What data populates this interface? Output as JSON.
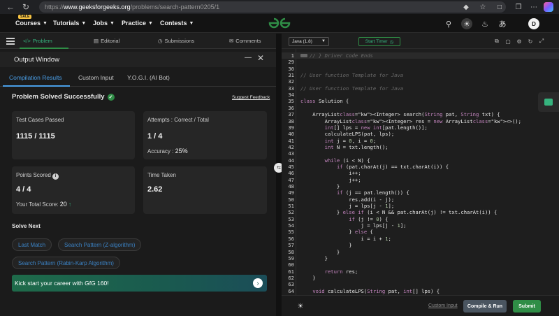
{
  "browser": {
    "url_prefix": "https://",
    "url_host": "www.geeksforgeeks.org",
    "url_path": "/problems/search-pattern0205/1"
  },
  "header": {
    "sale_badge": "SALE",
    "menu": [
      {
        "label": "Courses"
      },
      {
        "label": "Tutorials"
      },
      {
        "label": "Jobs"
      },
      {
        "label": "Practice"
      },
      {
        "label": "Contests"
      }
    ],
    "avatar_letter": "D"
  },
  "problem_tabs": [
    {
      "label": "Problem",
      "icon": "code-icon",
      "active": true
    },
    {
      "label": "Editorial",
      "icon": "book-icon",
      "active": false
    },
    {
      "label": "Submissions",
      "icon": "clock-icon",
      "active": false
    },
    {
      "label": "Comments",
      "icon": "comment-icon",
      "active": false
    }
  ],
  "output_window": {
    "title": "Output Window",
    "tabs": [
      {
        "label": "Compilation Results",
        "active": true
      },
      {
        "label": "Custom Input",
        "active": false
      },
      {
        "label": "Y.O.G.I. (AI Bot)",
        "active": false
      }
    ],
    "status": "Problem Solved Successfully",
    "suggest_feedback": "Suggest Feedback",
    "cards": {
      "test_cases": {
        "label": "Test Cases Passed",
        "value": "1115 / 1115"
      },
      "attempts": {
        "label": "Attempts : Correct / Total",
        "value": "1 / 4",
        "accuracy_label": "Accuracy :",
        "accuracy_value": "25%"
      },
      "points": {
        "label": "Points Scored",
        "value": "4 / 4",
        "total_label": "Your Total Score:",
        "total_value": "20"
      },
      "time": {
        "label": "Time Taken",
        "value": "2.62"
      }
    },
    "solve_next_title": "Solve Next",
    "solve_next": [
      "Last Match",
      "Search Pattern (Z-algorithm)",
      "Search Pattern (Rabin-Karp Algorithm)"
    ],
    "banner": "Kick start your career with GfG 160!"
  },
  "editor": {
    "language": "Java (1.8)",
    "timer_label": "Start Timer",
    "custom_input": "Custom Input",
    "compile_label": "Compile & Run",
    "submit_label": "Submit",
    "lines": [
      {
        "n": "1",
        "t": "// } Driver Code Ends"
      },
      {
        "n": "29",
        "t": ""
      },
      {
        "n": "30",
        "t": ""
      },
      {
        "n": "31",
        "t": "// User function Template for Java"
      },
      {
        "n": "32",
        "t": ""
      },
      {
        "n": "33",
        "t": "// User function Template for Java"
      },
      {
        "n": "34",
        "t": ""
      },
      {
        "n": "35",
        "t": "class Solution {"
      },
      {
        "n": "36",
        "t": ""
      },
      {
        "n": "37",
        "t": "    ArrayList<Integer> search(String pat, String txt) {"
      },
      {
        "n": "38",
        "t": "        ArrayList<Integer> res = new ArrayList<>();"
      },
      {
        "n": "39",
        "t": "        int[] lps = new int[pat.length()];"
      },
      {
        "n": "40",
        "t": "        calculateLPS(pat, lps);"
      },
      {
        "n": "41",
        "t": "        int j = 0, i = 0;"
      },
      {
        "n": "42",
        "t": "        int N = txt.length();"
      },
      {
        "n": "43",
        "t": ""
      },
      {
        "n": "44",
        "t": "        while (i < N) {"
      },
      {
        "n": "45",
        "t": "            if (pat.charAt(j) == txt.charAt(i)) {"
      },
      {
        "n": "46",
        "t": "                i++;"
      },
      {
        "n": "47",
        "t": "                j++;"
      },
      {
        "n": "48",
        "t": "            }"
      },
      {
        "n": "49",
        "t": "            if (j == pat.length()) {"
      },
      {
        "n": "50",
        "t": "                res.add(i - j);"
      },
      {
        "n": "51",
        "t": "                j = lps[j - 1];"
      },
      {
        "n": "52",
        "t": "            } else if (i < N && pat.charAt(j) != txt.charAt(i)) {"
      },
      {
        "n": "53",
        "t": "                if (j != 0) {"
      },
      {
        "n": "54",
        "t": "                    j = lps[j - 1];"
      },
      {
        "n": "55",
        "t": "                } else {"
      },
      {
        "n": "56",
        "t": "                    i = i + 1;"
      },
      {
        "n": "57",
        "t": "                }"
      },
      {
        "n": "58",
        "t": "            }"
      },
      {
        "n": "59",
        "t": "        }"
      },
      {
        "n": "60",
        "t": ""
      },
      {
        "n": "61",
        "t": "        return res;"
      },
      {
        "n": "62",
        "t": "    }"
      },
      {
        "n": "63",
        "t": ""
      },
      {
        "n": "64",
        "t": "    void calculateLPS(String pat, int[] lps) {"
      },
      {
        "n": "65",
        "t": "        int len = 0, i = 1;"
      }
    ]
  },
  "colors": {
    "brand_green": "#2f8d46",
    "link_blue": "#4a9fe8",
    "editor_bg": "#1e1e1e"
  }
}
